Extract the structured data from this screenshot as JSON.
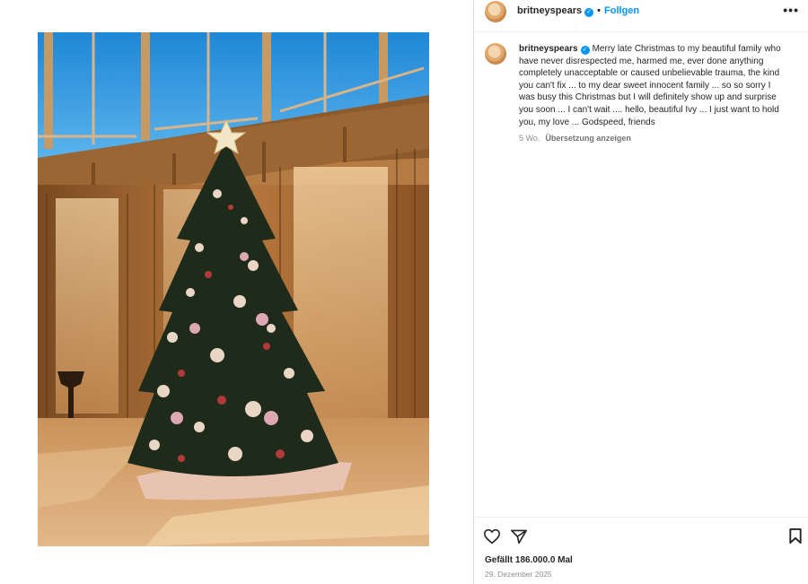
{
  "post": {
    "username": "britneyspears",
    "follow_label": "Follgen",
    "caption": "Merry late Christmas to my beautiful family who have never disrespected me, harmed me, ever done anything completely unacceptable or caused unbelievable trauma, the kind you can't fix ... to my dear sweet innocent family ... so so sorry I was busy this Christmas but I will definitely show up and surprise you soon ...  I can't wait .... hello, beautiful Ivy ... I just want to hold you, my love ... Godspeed, friends",
    "age": "5 Wo.",
    "translate_label": "Übersetzung anzeigen",
    "likes": "Gefällt 186.000.0 Mal",
    "date": "29. Dezember 2025"
  },
  "icons": {
    "more": "more-options-icon",
    "like": "heart-icon",
    "share": "share-icon",
    "save": "bookmark-icon",
    "verified": "verified-badge-icon"
  },
  "colors": {
    "accent": "#0095f6",
    "text": "#262626",
    "muted": "#8e8e8e"
  }
}
